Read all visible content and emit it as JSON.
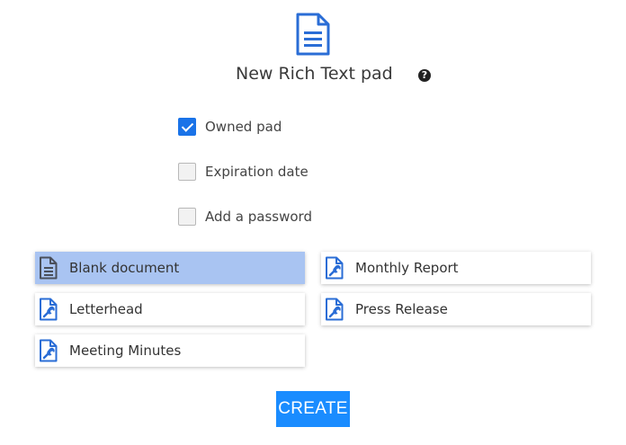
{
  "header": {
    "title": "New Rich Text pad",
    "help_icon": "question-circle-icon",
    "icon": "rich-text-document-icon"
  },
  "options": [
    {
      "label": "Owned pad",
      "checked": true
    },
    {
      "label": "Expiration date",
      "checked": false
    },
    {
      "label": "Add a password",
      "checked": false
    }
  ],
  "templates": [
    {
      "label": "Blank document",
      "icon": "document-icon",
      "selected": true
    },
    {
      "label": "Monthly Report",
      "icon": "document-wrench-icon",
      "selected": false
    },
    {
      "label": "Letterhead",
      "icon": "document-wrench-icon",
      "selected": false
    },
    {
      "label": "Press Release",
      "icon": "document-wrench-icon",
      "selected": false
    },
    {
      "label": "Meeting Minutes",
      "icon": "document-wrench-icon",
      "selected": false
    }
  ],
  "actions": {
    "create_label": "CREATE"
  },
  "colors": {
    "accent": "#1a73e8",
    "button": "#1a8cff",
    "selected_template": "#a9c4f2"
  }
}
